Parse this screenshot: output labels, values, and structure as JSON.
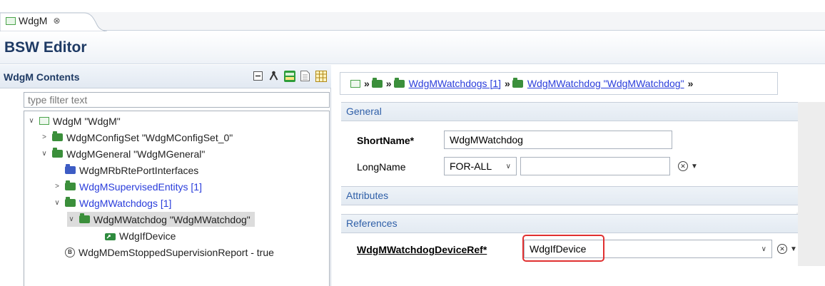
{
  "tab": {
    "label": "WdgM",
    "close": "⊗"
  },
  "editor": {
    "title": "BSW Editor"
  },
  "contents": {
    "title": "WdgM Contents",
    "filter_placeholder": "type filter text",
    "tree": [
      {
        "label": "WdgM \"WdgM\"",
        "icon": "module-icon",
        "expander": "∨"
      },
      {
        "label": "WdgMConfigSet \"WdgMConfigSet_0\"",
        "icon": "folder-icon",
        "expander": ">"
      },
      {
        "label": "WdgMGeneral \"WdgMGeneral\"",
        "icon": "folder-icon",
        "expander": "∨"
      },
      {
        "label": "WdgMRbRtePortInterfaces",
        "icon": "folder-icon"
      },
      {
        "label": "WdgMSupervisedEntitys [1]",
        "icon": "folder-icon",
        "expander": ">"
      },
      {
        "label": "WdgMWatchdogs [1]",
        "icon": "folder-icon",
        "expander": "∨"
      },
      {
        "label": "WdgMWatchdog \"WdgMWatchdog\"",
        "icon": "folder-icon",
        "expander": "∨"
      },
      {
        "label": "WdgIfDevice",
        "icon": "reference-icon"
      },
      {
        "label": "WdgMDemStoppedSupervisionReport - true",
        "icon": "parameter-icon"
      }
    ]
  },
  "breadcrumb": {
    "items": [
      "WdgMWatchdogs [1]",
      "WdgMWatchdog \"WdgMWatchdog\""
    ],
    "separator": "»"
  },
  "general": {
    "header": "General",
    "shortname_label": "ShortName*",
    "shortname_value": "WdgMWatchdog",
    "longname_label": "LongName",
    "longname_lang": "FOR-ALL",
    "longname_value": ""
  },
  "attributes": {
    "header": "Attributes"
  },
  "references": {
    "header": "References",
    "deviceref_label": "WdgMWatchdogDeviceRef*",
    "deviceref_value": "WdgIfDevice"
  },
  "colors": {
    "title": "#1e3a64",
    "link": "#2a3ddb",
    "section_header_text": "#2f5fa8",
    "highlight": "#e03030",
    "folder_green": "#3b8f3b",
    "folder_blue": "#3d5cc4"
  }
}
